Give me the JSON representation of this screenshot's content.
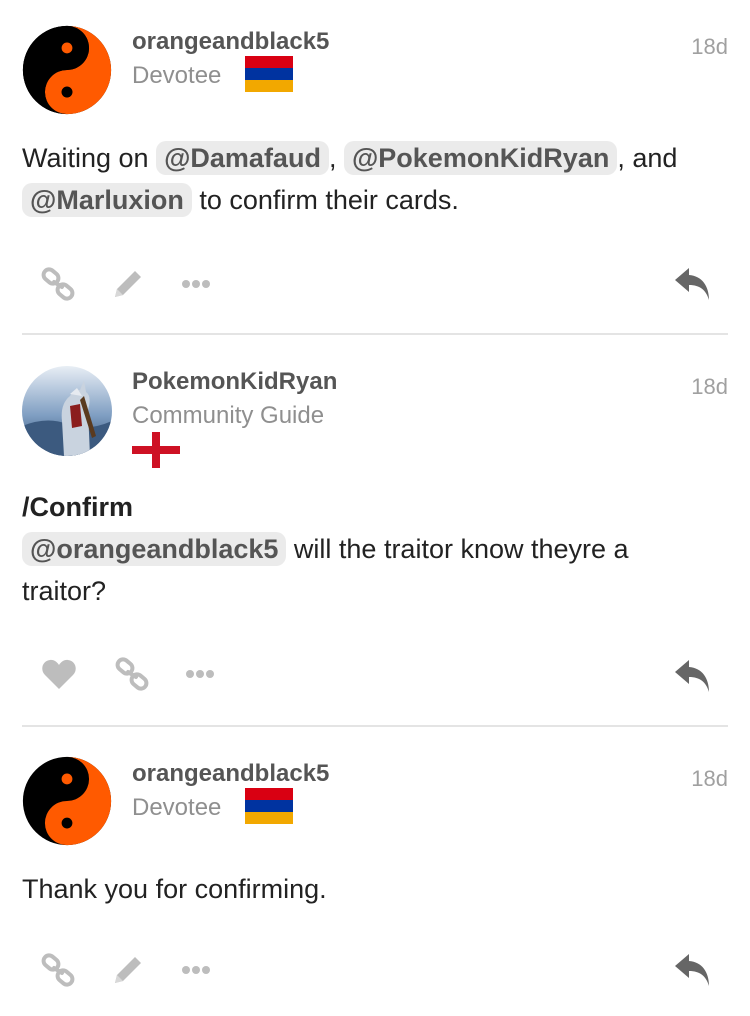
{
  "posts": [
    {
      "username": "orangeandblack5",
      "title": "Devotee",
      "date": "18d",
      "body": {
        "p1": "Waiting on ",
        "m1": "@Damafaud",
        "p2": ", ",
        "m2": "@PokemonKidRyan",
        "p3": ", and",
        "m3": "@Marluxion",
        "p4": " to confirm their cards."
      },
      "flag": "armenia-flag",
      "actions": [
        "link-icon",
        "pencil-icon",
        "more-icon",
        "reply-icon"
      ]
    },
    {
      "username": "PokemonKidRyan",
      "title": "Community Guide",
      "date": "18d",
      "body": {
        "heading": "/Confirm",
        "m1": "@orangeandblack5",
        "p1": " will the traitor know theyre a",
        "p2": "traitor?"
      },
      "flag": "england-flag",
      "actions": [
        "heart-icon",
        "link-icon",
        "more-icon",
        "reply-icon"
      ]
    },
    {
      "username": "orangeandblack5",
      "title": "Devotee",
      "date": "18d",
      "body": {
        "p1": "Thank you for confirming."
      },
      "flag": "armenia-flag",
      "actions": [
        "link-icon",
        "pencil-icon",
        "more-icon",
        "reply-icon"
      ]
    }
  ],
  "colors": {
    "flag_red": "#d90012",
    "flag_blue": "#0033a0",
    "flag_orange": "#f2a800",
    "yinyang_orange": "#ff5a00",
    "england_red": "#ce1124",
    "icon_gray": "#bdbdbd",
    "reply_gray": "#666666"
  }
}
